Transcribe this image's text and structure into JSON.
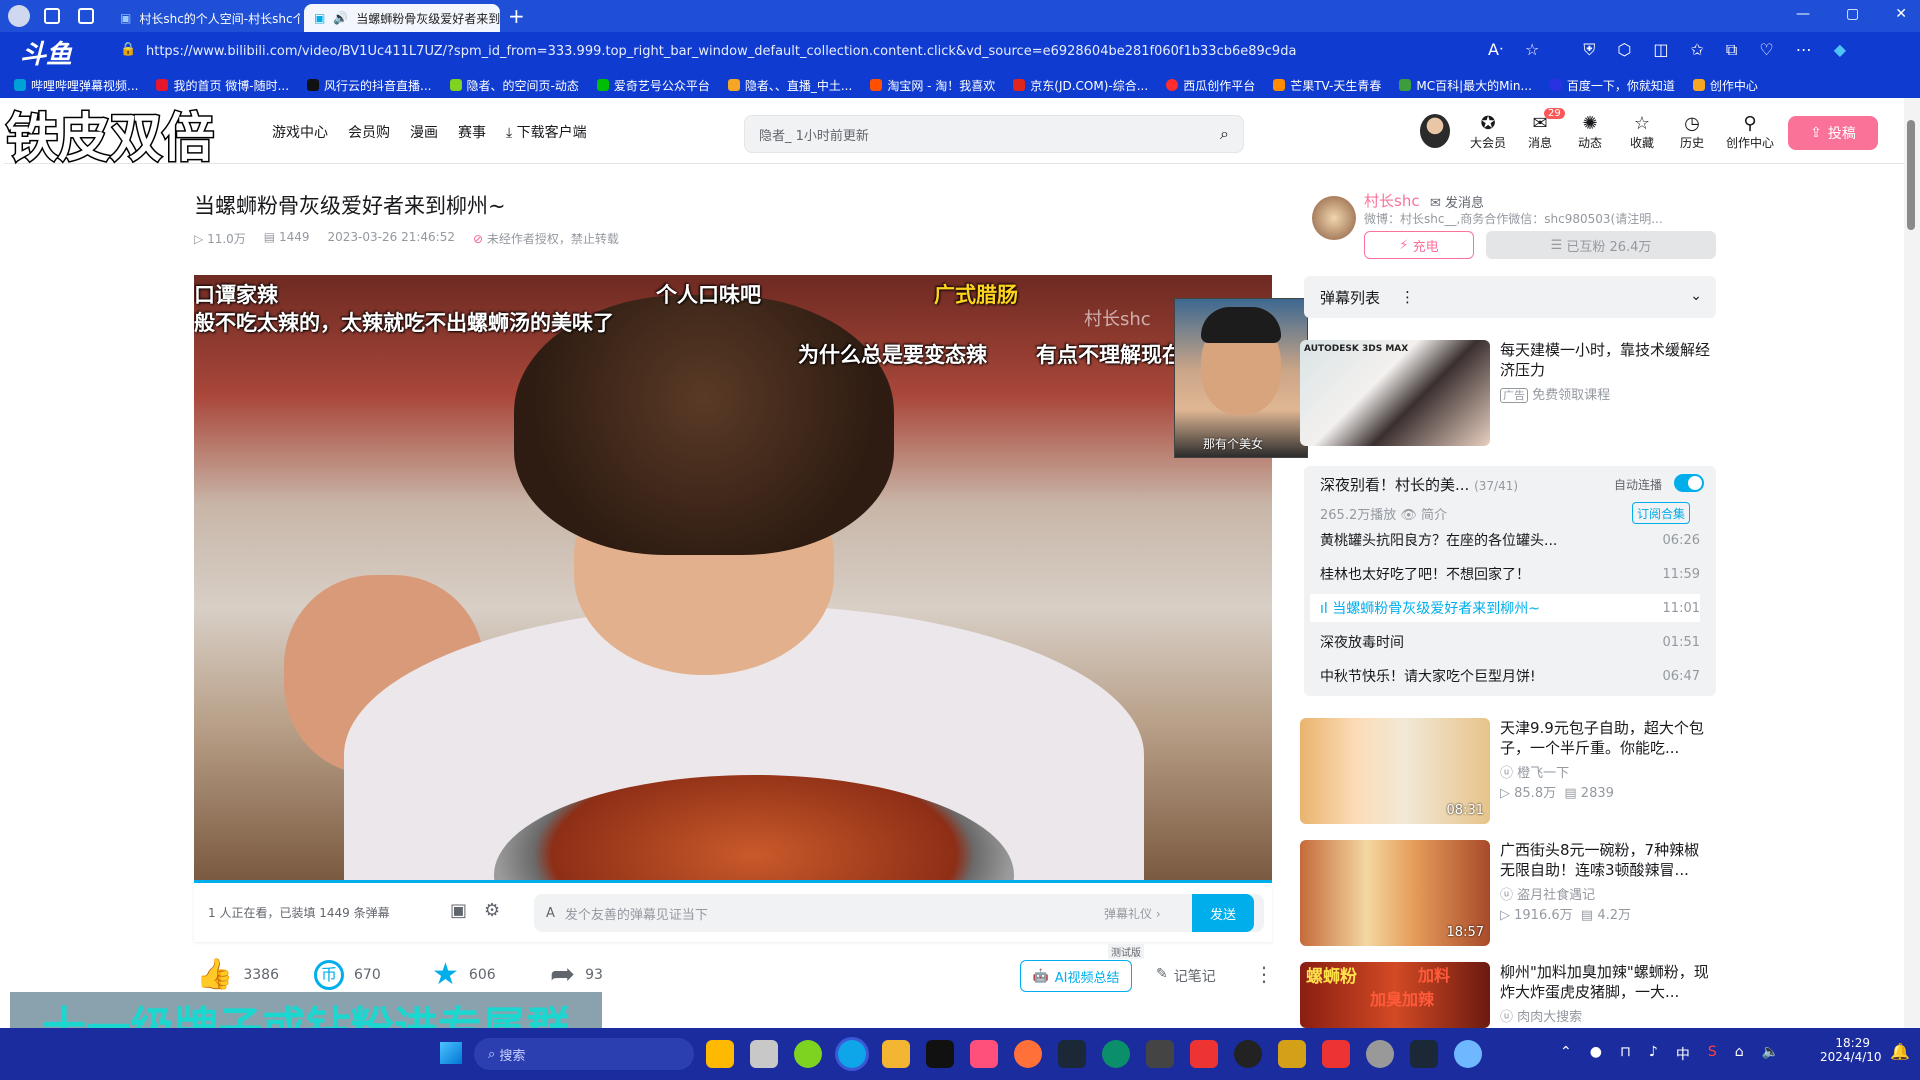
{
  "browser": {
    "tabs": [
      {
        "label": "村长shc的个人空间-村长shc个人..."
      },
      {
        "label": "当螺蛳粉骨灰级爱好者来到..."
      }
    ],
    "new_tab": "+",
    "url": "https://www.bilibili.com/video/BV1Uc411L7UZ/?spm_id_from=333.999.top_right_bar_window_default_collection.content.click&vd_source=e6928604be281f060f1b33cb6e89c9da",
    "bookmarks": [
      "哔哩哔哩弹幕视频...",
      "我的首页 微博-随时...",
      "风行云的抖音直播...",
      "隐者、的空间页-动态",
      "爱奇艺号公众平台",
      "隐者、、直播_中土...",
      "淘宝网 - 淘！我喜欢",
      "京东(JD.COM)-综合...",
      "西瓜创作平台",
      "芒果TV-天生青春",
      "MC百科|最大的Min...",
      "百度一下，你就知道",
      "创作中心"
    ],
    "window_controls": [
      "—",
      "▢",
      "✕"
    ]
  },
  "overlay": {
    "top_left_text": "铁皮双倍",
    "bottom_banner": "十一级牌子或钻粉进专属群",
    "douyu_logo": "斗鱼"
  },
  "header": {
    "nav": [
      "游戏中心",
      "会员购",
      "漫画",
      "赛事"
    ],
    "download": "下载客户端",
    "search_placeholder": "隐者_ 1小时前更新",
    "icons": [
      {
        "label": "大会员",
        "glyph": "✪"
      },
      {
        "label": "消息",
        "glyph": "✉",
        "badge": "29"
      },
      {
        "label": "动态",
        "glyph": "✺"
      },
      {
        "label": "收藏",
        "glyph": "☆"
      },
      {
        "label": "历史",
        "glyph": "◷"
      },
      {
        "label": "创作中心",
        "glyph": "⚲"
      }
    ],
    "upload": "投稿"
  },
  "video": {
    "title": "当螺蛳粉骨灰级爱好者来到柳州~",
    "views": "11.0万",
    "danmaku_count": "1449",
    "date": "2023-03-26 21:46:52",
    "copyright": "未经作者授权，禁止转载",
    "danmaku_lines": [
      "口谭家辣",
      "个人口味吧",
      "广式腊肠",
      "般不吃太辣的，太辣就吃不出螺蛳汤的美味了",
      "为什么总是要变态辣",
      "有点不理解现在的人",
      "村长shc"
    ],
    "cam_caption": "那有个美女"
  },
  "danmaku_bar": {
    "status": "1 人正在看，已装填 1449 条弹幕",
    "placeholder": "发个友善的弹幕见证当下",
    "etiquette": "弹幕礼仪 ›",
    "send": "发送"
  },
  "actions": {
    "like": "3386",
    "coin": "670",
    "fav": "606",
    "share": "93",
    "ai_summary": "AI视频总结",
    "beta": "测试版",
    "notes": "记笔记",
    "more": "⋮"
  },
  "uploader": {
    "name": "村长shc",
    "message": "发消息",
    "desc": "微博：村长shc__,商务合作微信：shc980503(请注明...",
    "charge": "充电",
    "fans": "已互粉 26.4万"
  },
  "danmaku_list": {
    "label": "弹幕列表"
  },
  "ad": {
    "title": "每天建模一小时，靠技术缓解经济压力",
    "tag": "广告",
    "sub": "免费领取课程",
    "brand": "AUTODESK 3DS MAX"
  },
  "collection": {
    "title": "深夜别看！村长的美...",
    "progress": "(37/41)",
    "autoplay": "自动连播",
    "plays": "265.2万播放",
    "intro": "简介",
    "subscribe": "订阅合集",
    "episodes": [
      {
        "title": "黄桃罐头抗阳良方？在座的各位罐头...",
        "dur": "06:26",
        "active": false
      },
      {
        "title": "桂林也太好吃了吧！不想回家了！",
        "dur": "11:59",
        "active": false
      },
      {
        "title": "当螺蛳粉骨灰级爱好者来到柳州~",
        "dur": "11:01",
        "active": true
      },
      {
        "title": "深夜放毒时间",
        "dur": "01:51",
        "active": false
      },
      {
        "title": "中秋节快乐！请大家吃个巨型月饼!",
        "dur": "06:47",
        "active": false
      }
    ]
  },
  "recommend": [
    {
      "title": "天津9.9元包子自助，超大个包子，一个半斤重。你能吃...",
      "up": "橙飞一下",
      "views": "85.8万",
      "dm": "2839",
      "dur": "08:31"
    },
    {
      "title": "广西街头8元一碗粉，7种辣椒无限自助！连嗦3顿酸辣冒...",
      "up": "盗月社食遇记",
      "views": "1916.6万",
      "dm": "4.2万",
      "dur": "18:57"
    },
    {
      "title": "柳州\"加料加臭加辣\"螺蛳粉，现炸大炸蛋虎皮猪脚，一大...",
      "up": "肉肉大搜索",
      "thumb_text": [
        "螺蛳粉",
        "加料",
        "加臭加辣"
      ]
    }
  ],
  "taskbar": {
    "search": "搜索",
    "time": "18:29",
    "date": "2024/4/10",
    "ime": "中"
  }
}
